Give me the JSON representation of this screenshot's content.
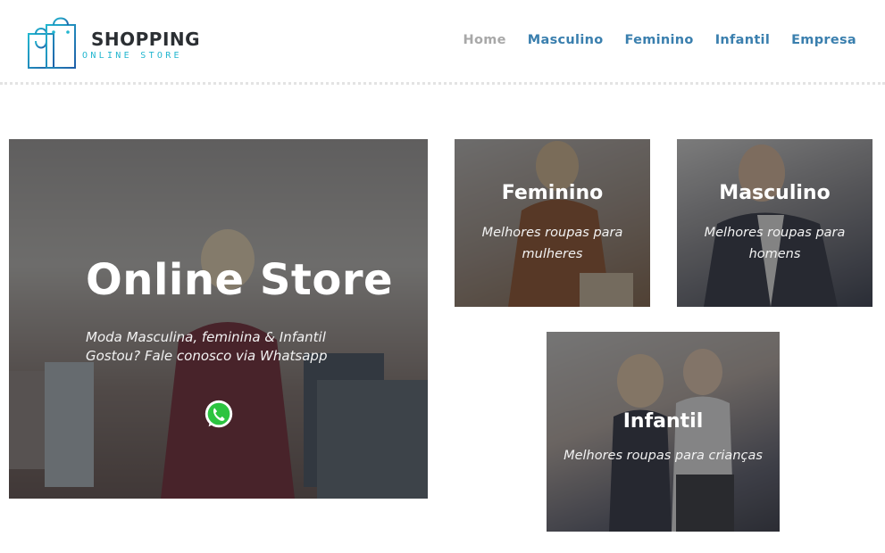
{
  "brand": {
    "title": "SHOPPING",
    "subtitle": "ONLINE STORE",
    "icon": "shopping-bags-icon",
    "colors": {
      "dark": "#2b2f33",
      "accent": "#22b6cf",
      "nav": "#3a7fae",
      "nav_active": "#a8a8a8"
    }
  },
  "nav": {
    "items": [
      {
        "label": "Home",
        "active": true
      },
      {
        "label": "Masculino",
        "active": false
      },
      {
        "label": "Feminino",
        "active": false
      },
      {
        "label": "Infantil",
        "active": false
      },
      {
        "label": "Empresa",
        "active": false
      }
    ]
  },
  "hero": {
    "title": "Online Store",
    "line1": "Moda Masculina, feminina & Infantil",
    "line2": "Gostou? Fale conosco via Whatsapp",
    "cta_icon": "whatsapp-icon"
  },
  "categories": {
    "feminino": {
      "title": "Feminino",
      "text": "Melhores roupas para mulheres"
    },
    "masculino": {
      "title": "Masculino",
      "text": "Melhores roupas para homens"
    },
    "infantil": {
      "title": "Infantil",
      "text": "Melhores roupas para crianças"
    }
  }
}
